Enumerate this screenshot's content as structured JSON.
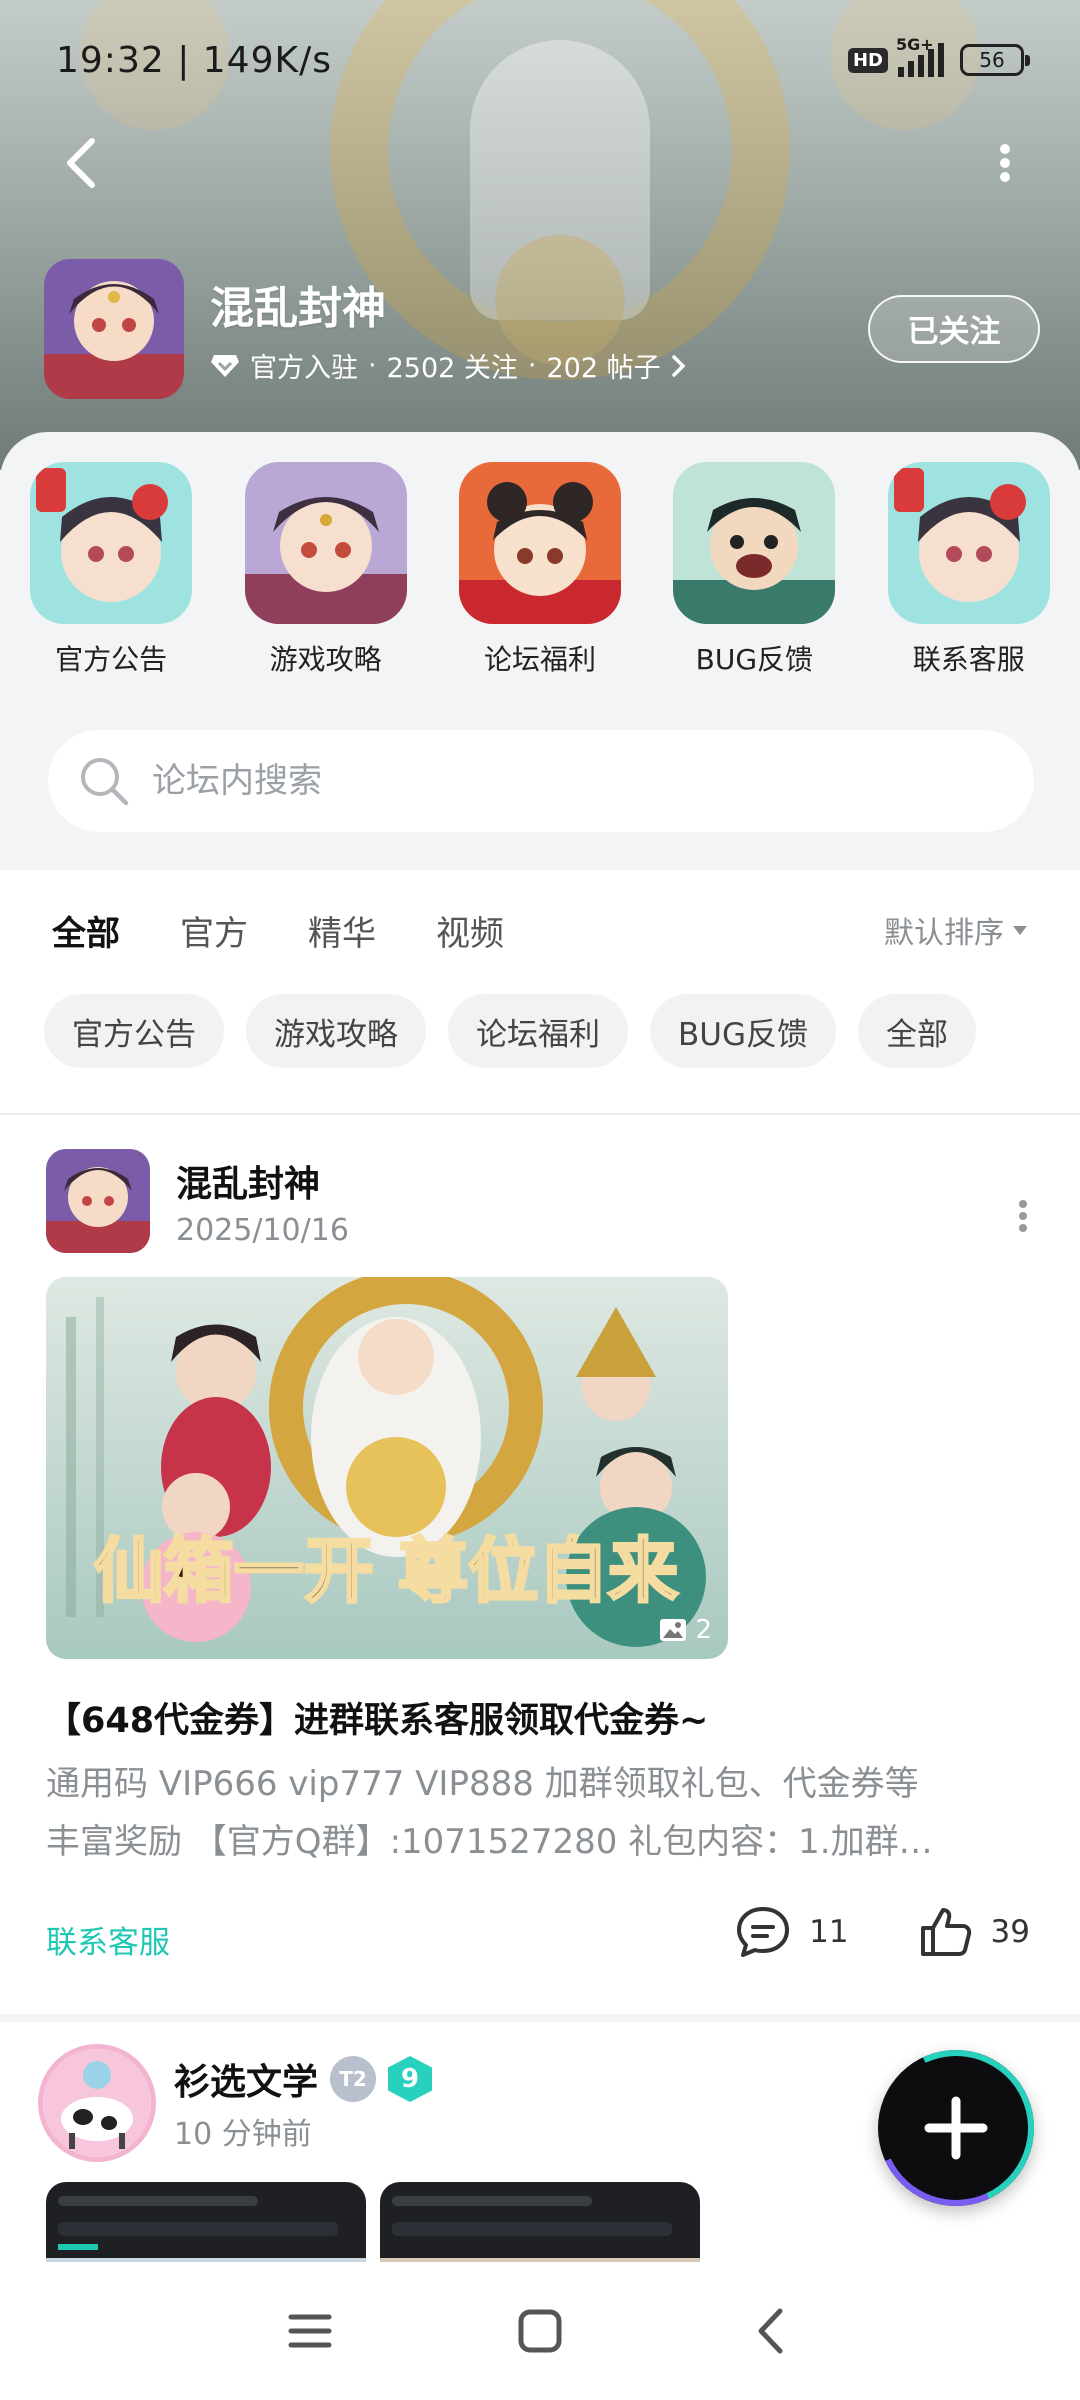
{
  "status_bar": {
    "time_speed": "19:32 | 149K/s",
    "hd": "HD",
    "network": "5G+",
    "battery": "56"
  },
  "game": {
    "name": "混乱封神",
    "verified": "官方入驻",
    "followers": "2502 关注",
    "posts": "202 帖子",
    "follow_label": "已关注"
  },
  "shortcuts": [
    {
      "label": "官方公告"
    },
    {
      "label": "游戏攻略"
    },
    {
      "label": "论坛福利"
    },
    {
      "label": "BUG反馈"
    },
    {
      "label": "联系客服"
    }
  ],
  "search": {
    "placeholder": "论坛内搜索"
  },
  "tabs": [
    {
      "label": "全部",
      "active": true
    },
    {
      "label": "官方"
    },
    {
      "label": "精华"
    },
    {
      "label": "视频"
    }
  ],
  "sort_label": "默认排序",
  "chips": [
    "官方公告",
    "游戏攻略",
    "论坛福利",
    "BUG反馈",
    "全部"
  ],
  "post": {
    "author": "混乱封神",
    "date": "2025/10/16",
    "image_text": "仙箱一开 尊位自来",
    "image_count": "2",
    "title": "【648代金券】进群联系客服领取代金券~",
    "excerpt_line1": "通用码 VIP666 vip777 VIP888 加群领取礼包、代金券等",
    "excerpt_line2": "丰富奖励 【官方Q群】:1071527280  礼包内容：1.加群…",
    "tag": "联系客服",
    "comments": "11",
    "likes": "39"
  },
  "post2": {
    "author": "衫选文学",
    "badge_level": "9",
    "time": "10 分钟前"
  },
  "colors": {
    "accent": "#1fc8b3",
    "panel_bg": "#f3f4f6"
  }
}
